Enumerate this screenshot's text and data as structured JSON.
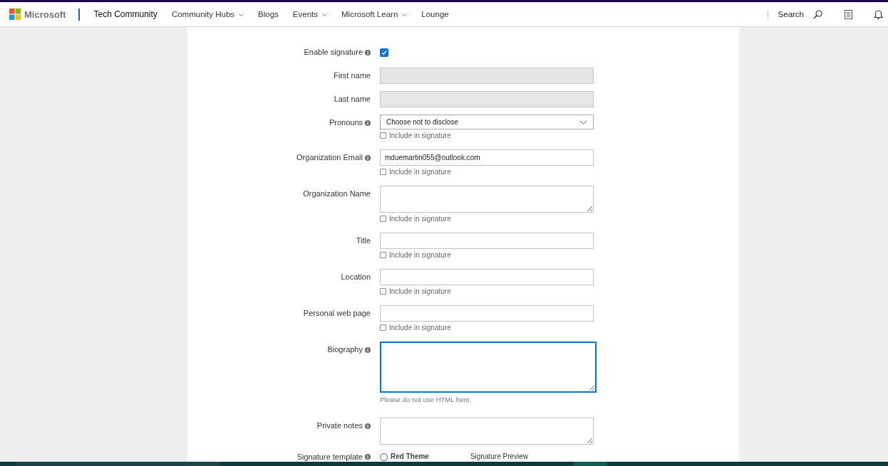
{
  "nav": {
    "brand": "Microsoft",
    "site": "Tech Community",
    "links": [
      {
        "label": "Community Hubs",
        "dropdown": true
      },
      {
        "label": "Blogs",
        "dropdown": false
      },
      {
        "label": "Events",
        "dropdown": true
      },
      {
        "label": "Microsoft Learn",
        "dropdown": true
      },
      {
        "label": "Lounge",
        "dropdown": false
      }
    ],
    "search_label": "Search"
  },
  "form": {
    "fields": [
      {
        "kind": "checkbox",
        "label": "Enable signature",
        "info": true,
        "checked": true
      },
      {
        "kind": "text",
        "label": "First name",
        "info": false,
        "disabled": true,
        "focused": false
      },
      {
        "kind": "text",
        "label": "Last name",
        "info": false,
        "disabled": true,
        "focused": false
      },
      {
        "kind": "select",
        "label": "Pronouns",
        "info": true,
        "value": "Choose not to disclose",
        "include": {
          "label": "Include in signature",
          "checked": false
        }
      },
      {
        "kind": "text",
        "label": "Organization Email",
        "info": true,
        "value": "mduemartin055@outlook.com",
        "disabled": false,
        "focused": false,
        "include": {
          "label": "Include in signature",
          "checked": false
        }
      },
      {
        "kind": "textarea",
        "label": "Organization Name",
        "info": false,
        "disabled": false,
        "focused": false,
        "include": {
          "label": "Include in signature",
          "checked": false
        }
      },
      {
        "kind": "text",
        "label": "Title",
        "info": false,
        "disabled": false,
        "focused": false,
        "include": {
          "label": "Include in signature",
          "checked": false
        }
      },
      {
        "kind": "text",
        "label": "Location",
        "info": false,
        "disabled": false,
        "focused": false,
        "include": {
          "label": "Include in signature",
          "checked": false
        }
      },
      {
        "kind": "text",
        "label": "Personal web page",
        "info": false,
        "disabled": false,
        "focused": false,
        "include": {
          "label": "Include in signature",
          "checked": false
        }
      },
      {
        "kind": "long-textarea",
        "label": "Biography",
        "info": true,
        "disabled": false,
        "focused": true,
        "hint": "Please do not use HTML here."
      },
      {
        "kind": "textarea",
        "label": "Private notes",
        "info": true,
        "disabled": false,
        "focused": false
      },
      {
        "kind": "radio",
        "label": "Signature template",
        "info": true,
        "options": [
          {
            "label": "Red Theme",
            "selected": false
          }
        ],
        "preview_label": "Signature Preview"
      }
    ]
  }
}
